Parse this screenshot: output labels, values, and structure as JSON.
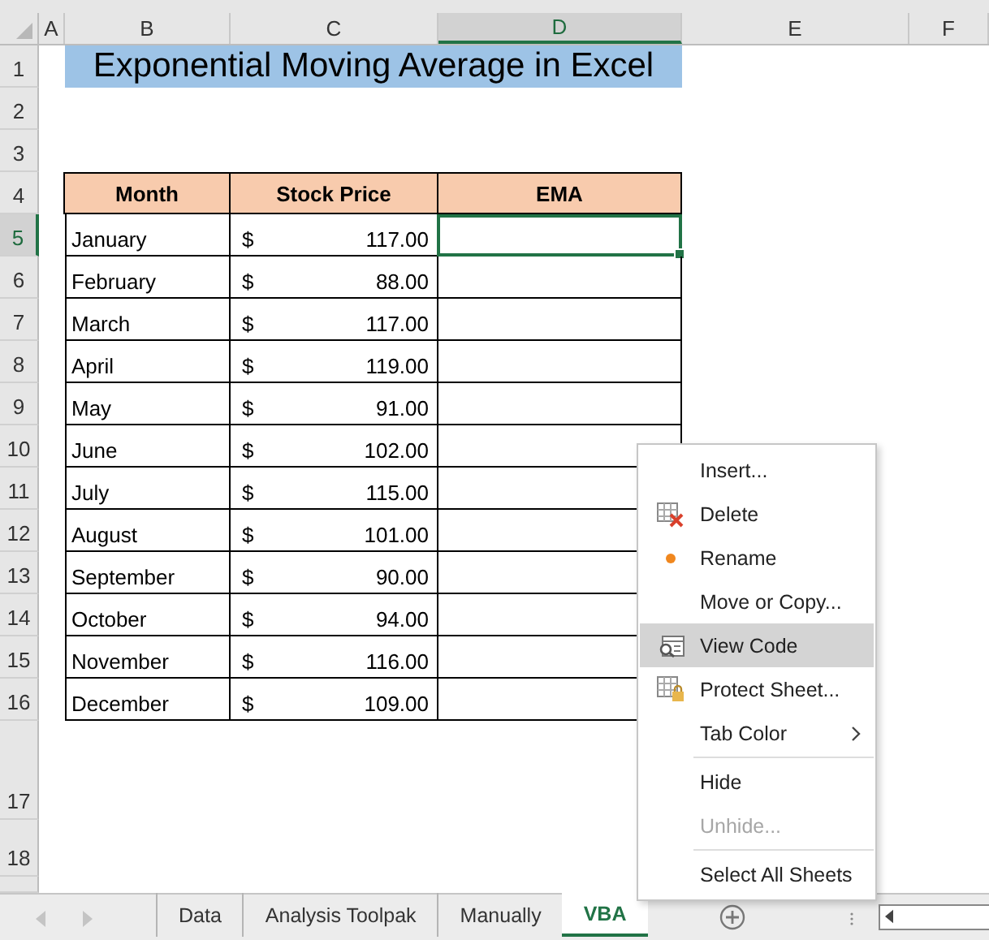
{
  "columns": [
    {
      "label": "A",
      "selected": false
    },
    {
      "label": "B",
      "selected": false
    },
    {
      "label": "C",
      "selected": false
    },
    {
      "label": "D",
      "selected": true
    },
    {
      "label": "E",
      "selected": false
    },
    {
      "label": "F",
      "selected": false
    }
  ],
  "rows": [
    {
      "label": "1",
      "selected": false
    },
    {
      "label": "2",
      "selected": false
    },
    {
      "label": "3",
      "selected": false
    },
    {
      "label": "4",
      "selected": false
    },
    {
      "label": "5",
      "selected": true
    },
    {
      "label": "6",
      "selected": false
    },
    {
      "label": "7",
      "selected": false
    },
    {
      "label": "8",
      "selected": false
    },
    {
      "label": "9",
      "selected": false
    },
    {
      "label": "10",
      "selected": false
    },
    {
      "label": "11",
      "selected": false
    },
    {
      "label": "12",
      "selected": false
    },
    {
      "label": "13",
      "selected": false
    },
    {
      "label": "14",
      "selected": false
    },
    {
      "label": "15",
      "selected": false
    },
    {
      "label": "16",
      "selected": false
    },
    {
      "label": "17",
      "selected": false
    },
    {
      "label": "18",
      "selected": false
    }
  ],
  "title": "Exponential Moving Average in Excel",
  "table": {
    "headers": [
      "Month",
      "Stock Price",
      "EMA"
    ],
    "rows": [
      {
        "month": "January",
        "currency": "$",
        "price": "117.00",
        "ema_selected": true
      },
      {
        "month": "February",
        "currency": "$",
        "price": "88.00",
        "ema_selected": false
      },
      {
        "month": "March",
        "currency": "$",
        "price": "117.00",
        "ema_selected": false
      },
      {
        "month": "April",
        "currency": "$",
        "price": "119.00",
        "ema_selected": false
      },
      {
        "month": "May",
        "currency": "$",
        "price": "91.00",
        "ema_selected": false
      },
      {
        "month": "June",
        "currency": "$",
        "price": "102.00",
        "ema_selected": false
      },
      {
        "month": "July",
        "currency": "$",
        "price": "115.00",
        "ema_selected": false
      },
      {
        "month": "August",
        "currency": "$",
        "price": "101.00",
        "ema_selected": false
      },
      {
        "month": "September",
        "currency": "$",
        "price": "90.00",
        "ema_selected": false
      },
      {
        "month": "October",
        "currency": "$",
        "price": "94.00",
        "ema_selected": false
      },
      {
        "month": "November",
        "currency": "$",
        "price": "116.00",
        "ema_selected": false
      },
      {
        "month": "December",
        "currency": "$",
        "price": "109.00",
        "ema_selected": false
      }
    ]
  },
  "context_menu": [
    {
      "kind": "plain",
      "label": "Insert...",
      "highlighted": false,
      "disabled": false
    },
    {
      "kind": "delete",
      "label": "Delete",
      "highlighted": false,
      "disabled": false
    },
    {
      "kind": "rename",
      "label": "Rename",
      "highlighted": false,
      "disabled": false
    },
    {
      "kind": "plain",
      "label": "Move or Copy...",
      "highlighted": false,
      "disabled": false
    },
    {
      "kind": "code",
      "label": "View Code",
      "highlighted": true,
      "disabled": false
    },
    {
      "kind": "protect",
      "label": "Protect Sheet...",
      "highlighted": false,
      "disabled": false
    },
    {
      "kind": "submenu",
      "label": "Tab Color",
      "highlighted": false,
      "disabled": false
    },
    {
      "kind": "separator"
    },
    {
      "kind": "plain",
      "label": "Hide",
      "highlighted": false,
      "disabled": false
    },
    {
      "kind": "plain",
      "label": "Unhide...",
      "highlighted": false,
      "disabled": true
    },
    {
      "kind": "separator"
    },
    {
      "kind": "plain",
      "label": "Select All Sheets",
      "highlighted": false,
      "disabled": false
    }
  ],
  "sheet_tabs": [
    {
      "label": "Data",
      "selected": false
    },
    {
      "label": "Analysis Toolpak",
      "selected": false
    },
    {
      "label": "Manually",
      "selected": false
    },
    {
      "label": "VBA",
      "selected": true
    }
  ]
}
